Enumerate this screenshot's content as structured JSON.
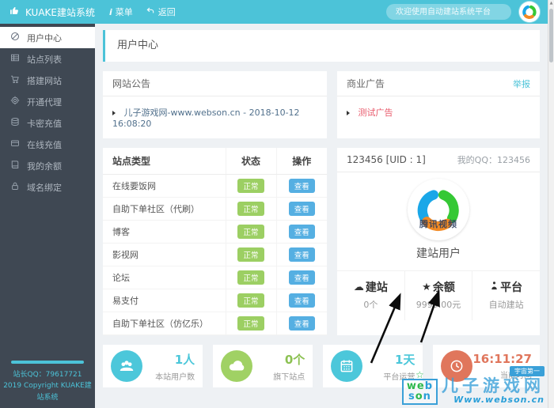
{
  "header": {
    "app_title": "KUAKE建站系统",
    "menu_label": "菜单",
    "menu_glyph": "i",
    "back_label": "返回",
    "search_placeholder": "欢迎使用自动建站系统平台"
  },
  "sidebar": {
    "items": [
      {
        "label": "用户中心",
        "icon": "user-center-icon",
        "active": true
      },
      {
        "label": "站点列表",
        "icon": "site-list-icon",
        "active": false
      },
      {
        "label": "搭建网站",
        "icon": "build-site-icon",
        "active": false
      },
      {
        "label": "开通代理",
        "icon": "agent-icon",
        "active": false
      },
      {
        "label": "卡密充值",
        "icon": "card-recharge-icon",
        "active": false
      },
      {
        "label": "在线充值",
        "icon": "online-recharge-icon",
        "active": false
      },
      {
        "label": "我的余额",
        "icon": "balance-icon",
        "active": false
      },
      {
        "label": "域名绑定",
        "icon": "domain-bind-icon",
        "active": false
      }
    ],
    "footer_qq": "站长QQ：79617721",
    "footer_copyright": "2019 Copyright KUAKE建站系统"
  },
  "page": {
    "title": "用户中心"
  },
  "announcement": {
    "title": "网站公告",
    "item": "儿子游戏网-www.webson.cn - 2018-10-12 16:08:20"
  },
  "ads": {
    "title": "商业广告",
    "report_label": "举报",
    "item": "测试广告"
  },
  "site_table": {
    "headers": [
      "站点类型",
      "状态",
      "操作"
    ],
    "status_label": "正常",
    "action_label": "查看",
    "rows": [
      "在线要饭网",
      "自助下单社区（代刷）",
      "博客",
      "影视网",
      "论坛",
      "易支付",
      "自助下单社区（仿亿乐）"
    ]
  },
  "profile": {
    "uid_text": "123456 [UID : 1]",
    "qq_text": "我的QQ：123456",
    "avatar_text": "腾讯视频",
    "role": "建站用户",
    "stats": [
      {
        "icon": "cloud-icon",
        "glyph": "☁",
        "label": "建站",
        "value": "0个"
      },
      {
        "icon": "star-icon",
        "glyph": "★",
        "label": "余额",
        "value": "9999.00元"
      },
      {
        "icon": "person-icon",
        "glyph": "",
        "label": "平台",
        "value": "自动建站"
      }
    ]
  },
  "stat_cards": [
    {
      "icon": "users-icon",
      "value": "1人",
      "label": "本站用户数",
      "color": "#4cc7da"
    },
    {
      "icon": "cloud-icon",
      "value": "0个",
      "label": "旗下站点",
      "color": "#a0d164"
    },
    {
      "icon": "calendar-icon",
      "value": "1天",
      "label": "平台运营",
      "color": "#4cc7da"
    },
    {
      "icon": "clock-icon",
      "value": "16:11:27",
      "label": "当前时间",
      "color": "#e0765c"
    }
  ],
  "watermark": {
    "logo_line1": "web",
    "logo_line2": "son",
    "badge": "宇宙第一",
    "title": "儿子游戏网",
    "url": "Www.webson.cn"
  },
  "colors": {
    "header": "#4cc3d8",
    "sidebar": "#3f4853",
    "accent": "#4cc3d8",
    "badge_green": "#9ccf63",
    "button_blue": "#55afe2",
    "card_orange": "#e0765c",
    "ad_red": "#e8586a",
    "announce_blue": "#51708c"
  }
}
